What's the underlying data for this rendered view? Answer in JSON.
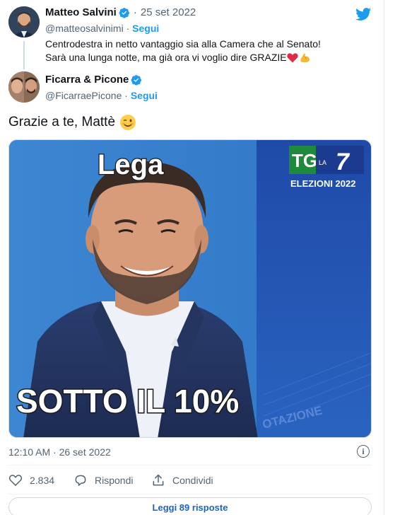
{
  "quoted_tweet": {
    "author_name": "Matteo Salvini",
    "handle": "@matteosalvinimi",
    "separator": "·",
    "date": "25 set 2022",
    "follow_label": "Segui",
    "text_line1": "Centrodestra in netto vantaggio sia alla Camera che al Senato!",
    "text_line2": "Sarà una lunga notte, ma già ora vi voglio dire GRAZIE",
    "emojis": [
      "red-heart",
      "flexed-biceps"
    ]
  },
  "tweet": {
    "author_name": "Ficarra & Picone",
    "handle": "@FicarraePicone",
    "separator": "·",
    "follow_label": "Segui",
    "text": "Grazie a te, Mattè",
    "emoji": "winking-face",
    "media": {
      "top_caption": "Lega",
      "bottom_caption": "SOTTO IL 10%",
      "logo_tg": "TG",
      "logo_la": "LA",
      "logo_7": "7",
      "logo_subtitle": "ELEZIONI 2022",
      "background_text": "OTAZIONE"
    },
    "timestamp": "12:10 AM · 26 set 2022",
    "likes": "2.834",
    "reply_label": "Rispondi",
    "share_label": "Condividi",
    "read_replies_label": "Leggi 89 risposte"
  },
  "colors": {
    "accent": "#1d9bf0",
    "like_accent": "#e0245e",
    "text": "#0f1419",
    "muted": "#536471",
    "media_blue": "#2f79c8",
    "logo_green": "#1f8a3b"
  }
}
